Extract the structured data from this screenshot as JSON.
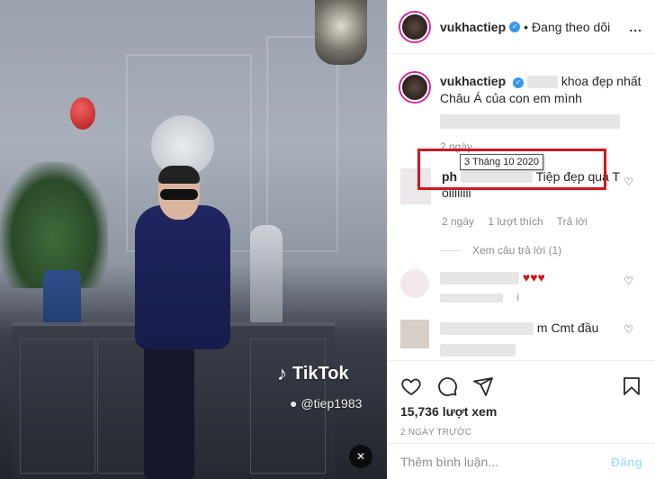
{
  "video": {
    "watermark_brand": "TikTok",
    "watermark_user": "@tiep1983",
    "mute_icon": "speaker-muted-icon"
  },
  "header": {
    "username": "vukhactiep",
    "dot": "•",
    "follow_status": "Đang theo dõi",
    "more": "..."
  },
  "caption": {
    "username": "vukhactiep",
    "text": "khoa đẹp nhất Châu Á của con em mình",
    "time": "2 ngày"
  },
  "comments": [
    {
      "username_partial": "ph",
      "text": "Tiệp đẹp quá T ôiiiiiiii",
      "time": "2 ngày",
      "likes": "1 lượt thích",
      "reply": "Trả lời",
      "tooltip": "3 Tháng 10 2020",
      "view_replies": "Xem câu trả lời (1)"
    },
    {
      "text": "♥♥♥",
      "sub": "i"
    },
    {
      "text": "m Cmt đầu"
    }
  ],
  "actions": {
    "views": "15,736 lượt xem",
    "ago": "2 NGÀY TRƯỚC"
  },
  "add_comment": {
    "placeholder": "Thêm bình luận...",
    "post": "Đăng"
  },
  "colors": {
    "verified": "#3897f0",
    "highlight": "#d0161f",
    "post_disabled": "#b2dffc",
    "heart_red": "#e0245e"
  }
}
